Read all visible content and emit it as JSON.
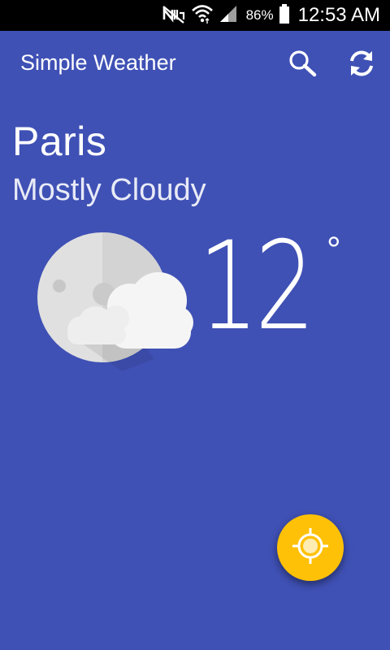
{
  "status_bar": {
    "battery_percent": "86%",
    "time": "12:53 AM",
    "icons": [
      "no-signal-icon",
      "wifi-icon",
      "cell-signal-icon",
      "battery-icon"
    ]
  },
  "app_bar": {
    "title": "Simple Weather",
    "actions": [
      "search-icon",
      "refresh-icon"
    ]
  },
  "weather": {
    "city": "Paris",
    "condition": "Mostly Cloudy",
    "temperature": "12",
    "degree_symbol": "°",
    "icon": "moon-with-clouds-icon"
  },
  "fab": {
    "icon": "my-location-icon"
  },
  "colors": {
    "background": "#3F51B5",
    "fab": "#FFC107",
    "status_bar": "#000000"
  }
}
